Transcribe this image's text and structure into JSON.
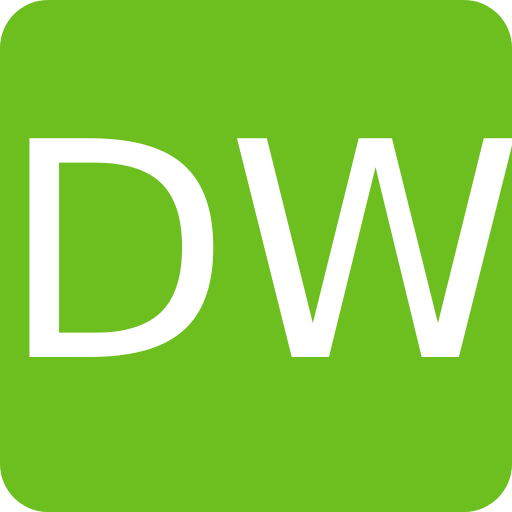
{
  "icon": {
    "label": "DW",
    "background_color": "#6cbf1f",
    "text_color": "#ffffff"
  }
}
